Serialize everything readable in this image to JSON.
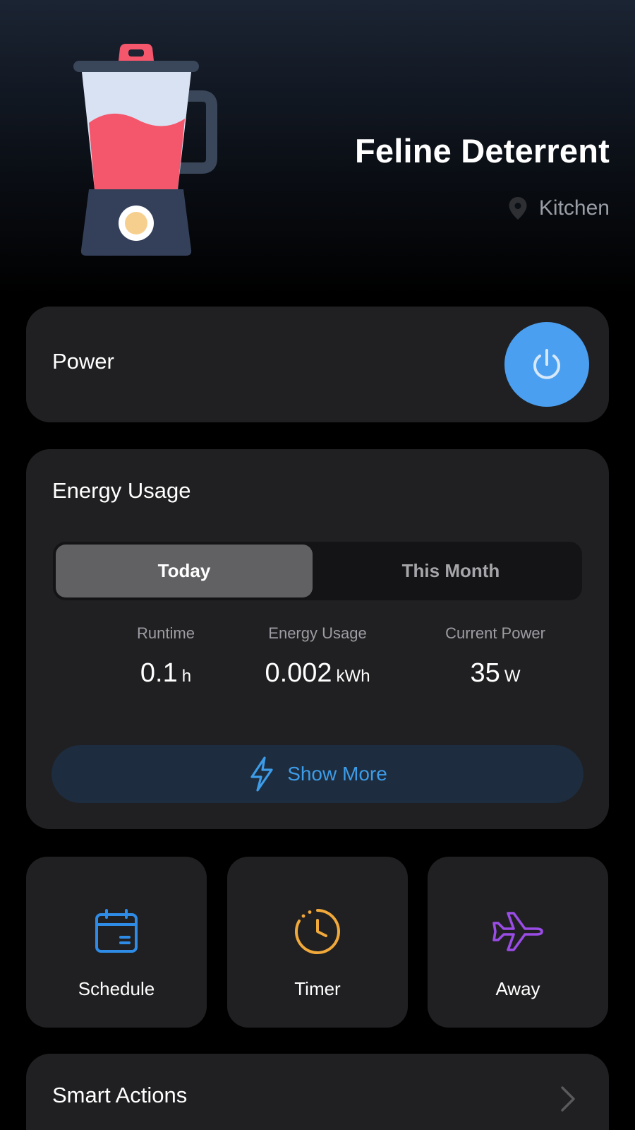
{
  "device": {
    "name": "Feline Deterrent",
    "location": "Kitchen",
    "image_icon": "blender-icon"
  },
  "power": {
    "label": "Power",
    "state": "on",
    "icon": "power-icon",
    "accent_color": "#4a9ff0"
  },
  "energy": {
    "title": "Energy Usage",
    "tabs": [
      {
        "label": "Today",
        "selected": true
      },
      {
        "label": "This Month",
        "selected": false
      }
    ],
    "stats": [
      {
        "label": "Runtime",
        "value": "0.1",
        "unit": "h"
      },
      {
        "label": "Energy Usage",
        "value": "0.002",
        "unit": "kWh"
      },
      {
        "label": "Current Power",
        "value": "35",
        "unit": "W"
      }
    ],
    "show_more_label": "Show More",
    "show_more_icon": "lightning-icon",
    "show_more_color": "#3d9ce8"
  },
  "actions": [
    {
      "label": "Schedule",
      "icon": "calendar-icon",
      "color": "#2e8be6"
    },
    {
      "label": "Timer",
      "icon": "clock-icon",
      "color": "#f2a93b"
    },
    {
      "label": "Away",
      "icon": "airplane-icon",
      "color": "#9a4ce6"
    }
  ],
  "smart_actions": {
    "label": "Smart Actions",
    "icon": "chevron-right-icon"
  },
  "colors": {
    "background": "#000000",
    "card": "#202022",
    "text_secondary": "#9c9ca2"
  }
}
